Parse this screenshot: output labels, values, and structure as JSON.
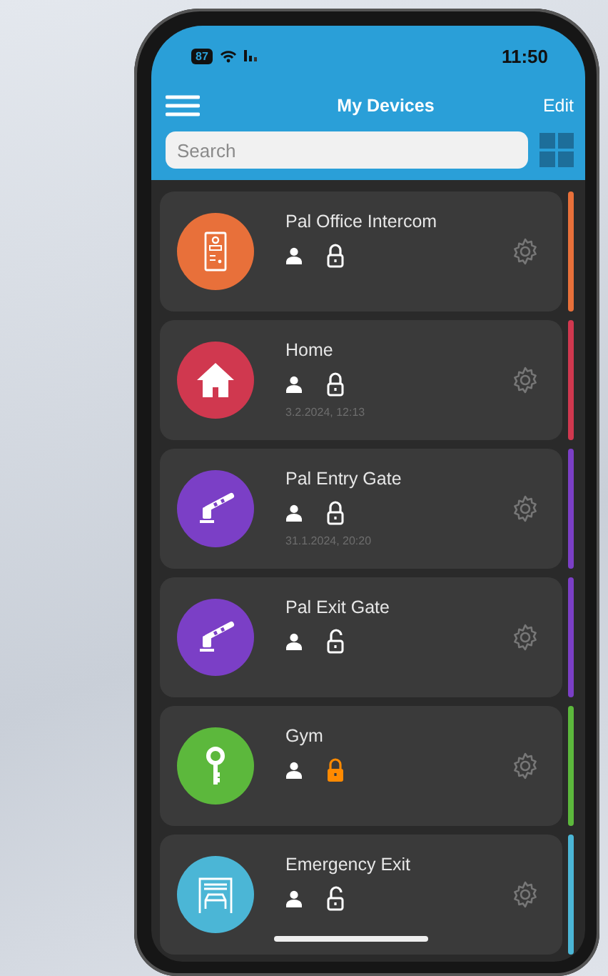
{
  "status_bar": {
    "battery": "87",
    "time": "11:50"
  },
  "header": {
    "title": "My Devices",
    "edit": "Edit"
  },
  "search": {
    "placeholder": "Search"
  },
  "devices": [
    {
      "name": "Pal Office Intercom",
      "kind": "intercom",
      "color": "#e8703a",
      "locked": true,
      "highlighted": false
    },
    {
      "name": "Home",
      "kind": "home",
      "color": "#d0384f",
      "locked": true,
      "highlighted": false,
      "date": "3.2.2024, 12:13"
    },
    {
      "name": "Pal Entry Gate",
      "kind": "barrier",
      "color": "#7b3fc6",
      "locked": true,
      "highlighted": false,
      "date": "31.1.2024, 20:20"
    },
    {
      "name": "Pal Exit Gate",
      "kind": "barrier",
      "color": "#7b3fc6",
      "locked": false,
      "highlighted": false
    },
    {
      "name": "Gym",
      "kind": "key",
      "color": "#5cb83c",
      "locked": true,
      "highlighted": true
    },
    {
      "name": "Emergency Exit",
      "kind": "garage",
      "color": "#4bb6d6",
      "locked": false,
      "highlighted": false
    }
  ]
}
